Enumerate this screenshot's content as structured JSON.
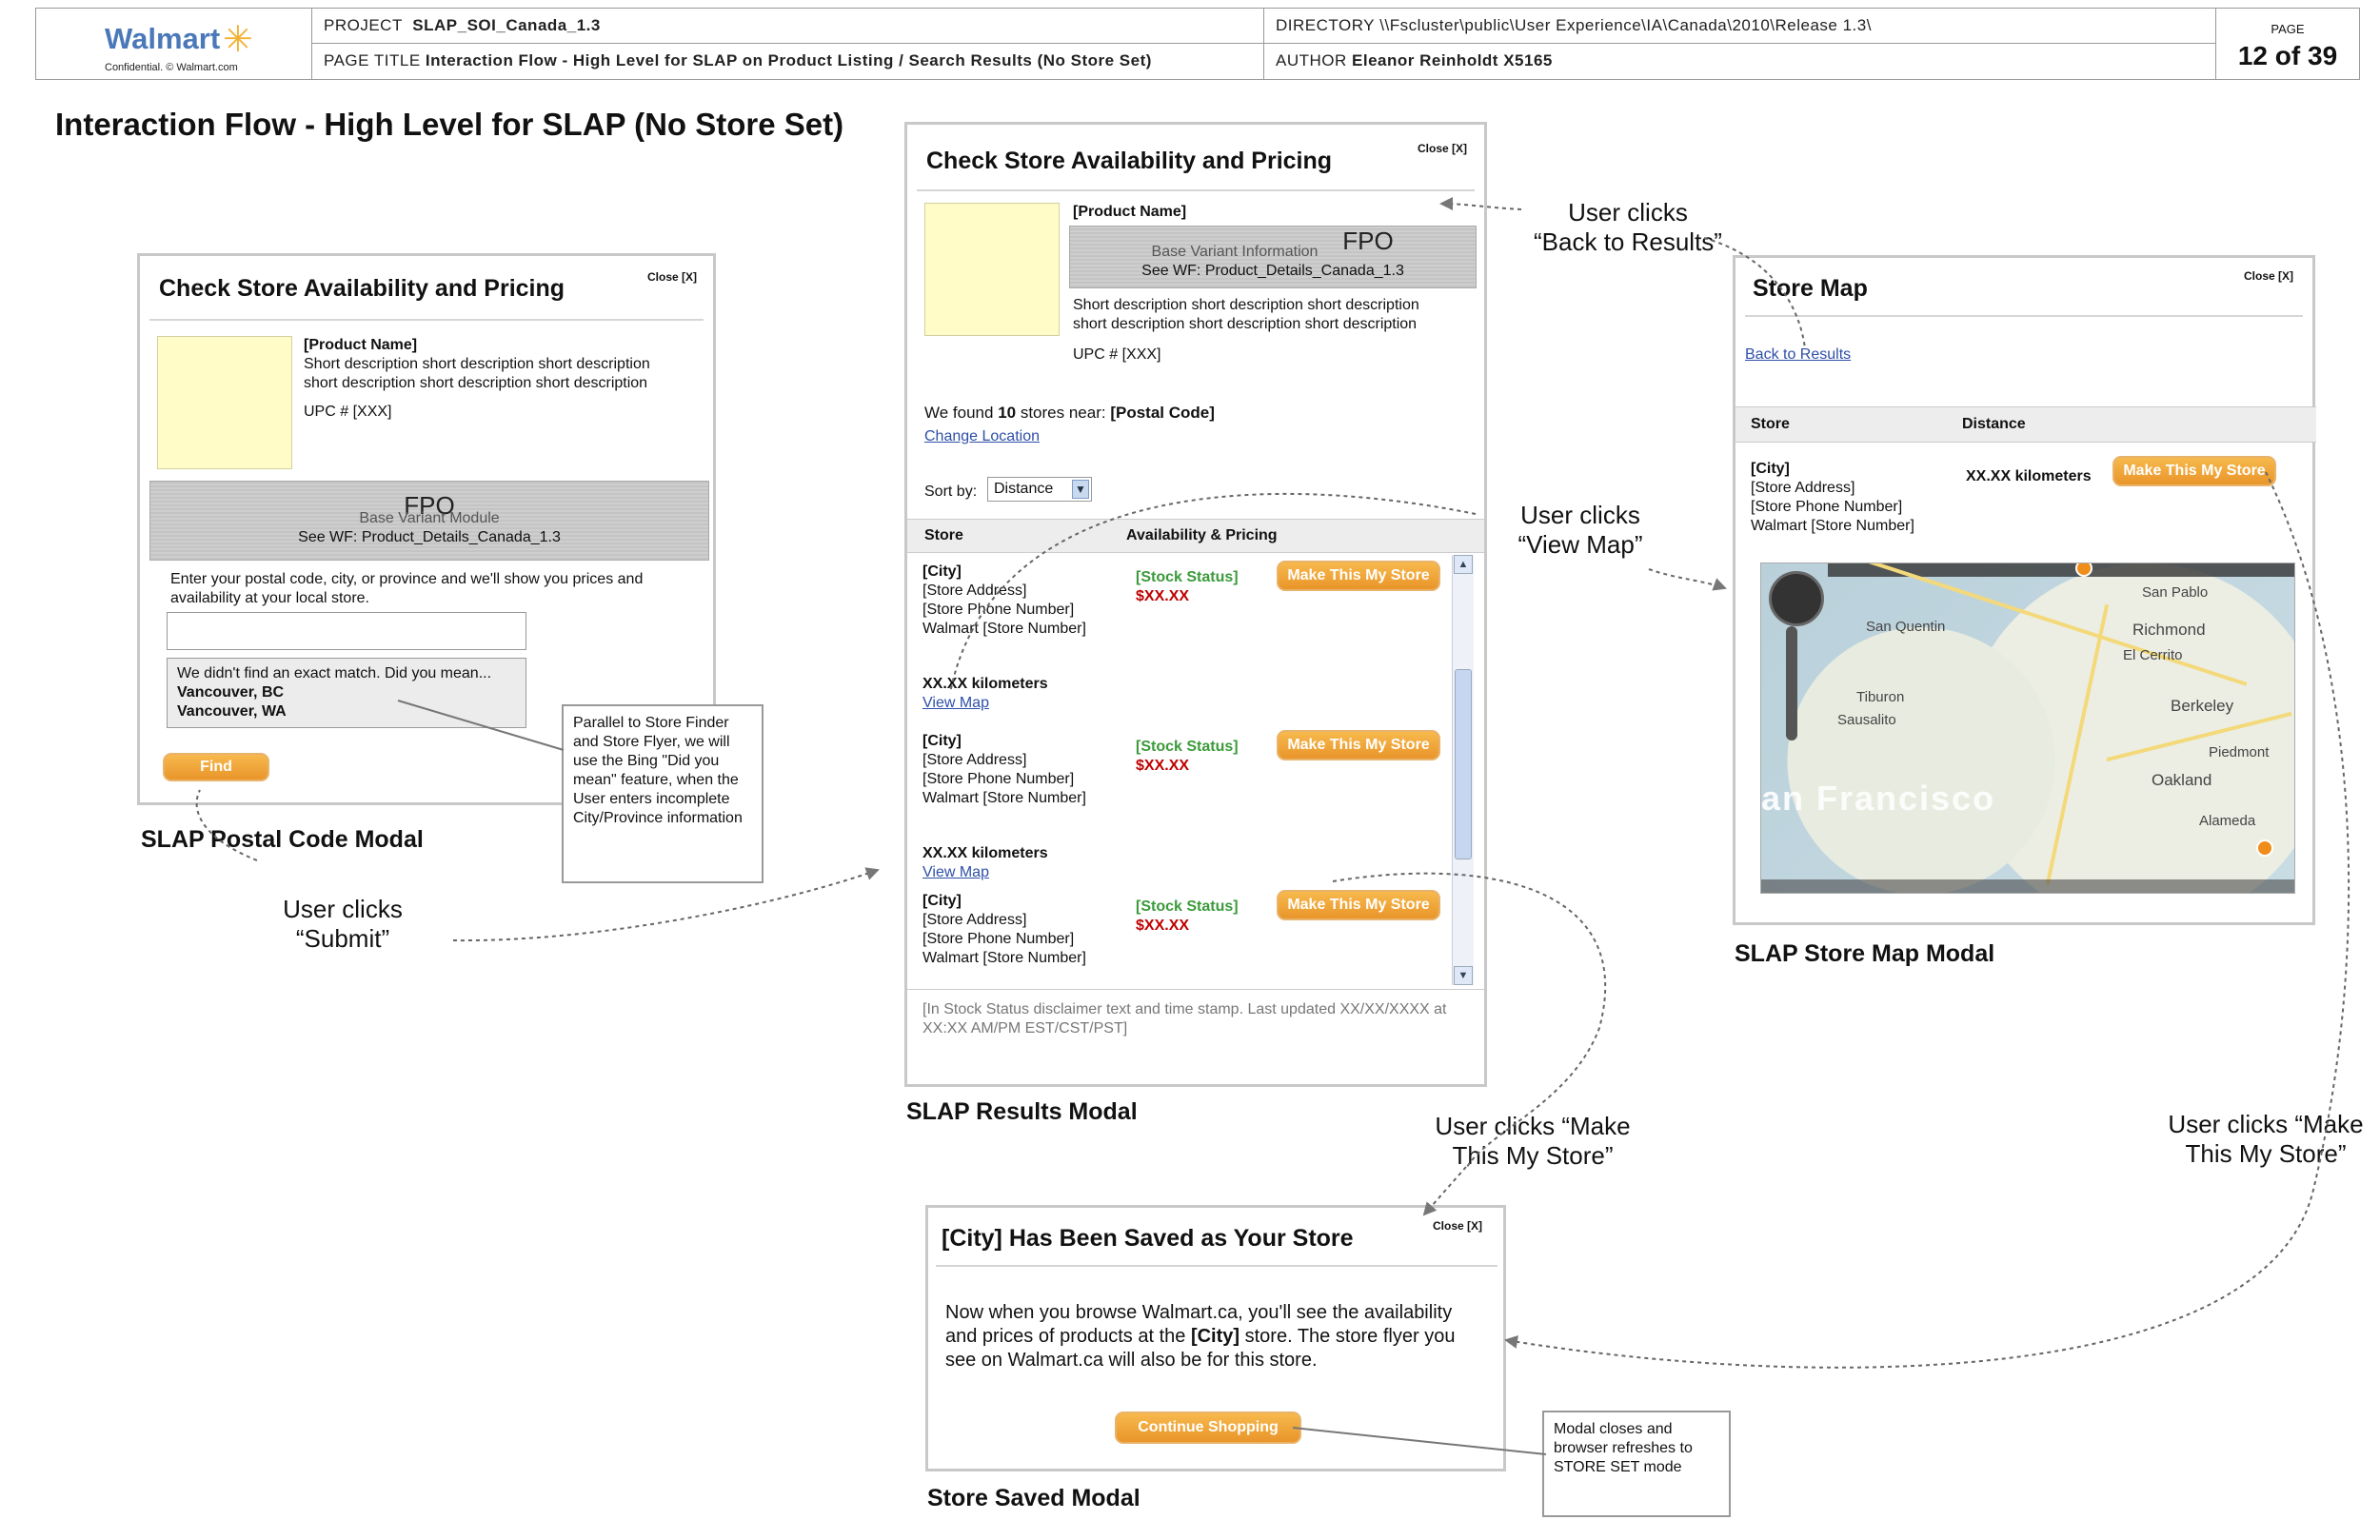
{
  "header": {
    "logo": "Walmart",
    "confidential": "Confidential. © Walmart.com",
    "project_label": "PROJECT",
    "project_value": "SLAP_SOI_Canada_1.3",
    "directory_label": "DIRECTORY",
    "directory_value": "\\\\Fscluster\\public\\User Experience\\IA\\Canada\\2010\\Release 1.3\\",
    "page_title_label": "PAGE TITLE",
    "page_title_value": "Interaction Flow - High Level  for SLAP on Product Listing /  Search Results (No Store Set)",
    "author_label": "AUTHOR",
    "author_value": "Eleanor Reinholdt X5165",
    "page_label": "PAGE",
    "page_value": "12 of 39"
  },
  "main_title": "Interaction Flow - High Level  for SLAP (No Store Set)",
  "postal_modal": {
    "title": "Check Store Availability and Pricing",
    "close": "Close [X]",
    "product_name": "[Product Name]",
    "desc1": "Short description short description short description",
    "desc2": "short description short description short description",
    "upc": "UPC # [XXX]",
    "fpo": "FPO",
    "fpo_sub": "Base Variant Module",
    "fpo_see": "See WF:  Product_Details_Canada_1.3",
    "prompt1": "Enter your postal code, city, or province and we'll show you prices and",
    "prompt2": "availability at your local store.",
    "suggest_q": "We didn't find an exact match. Did you mean...",
    "suggest_1": "Vancouver, BC",
    "suggest_2": "Vancouver, WA",
    "find": "Find",
    "caption": "SLAP Postal Code Modal"
  },
  "note_bing": "Parallel to Store Finder and Store Flyer, we will use the Bing \"Did you mean\" feature, when the User enters incomplete City/Province information",
  "callout_submit": [
    "User clicks",
    "“Submit”"
  ],
  "results_modal": {
    "title": "Check Store Availability and Pricing",
    "close": "Close [X]",
    "product_name": "[Product Name]",
    "fpo": "FPO",
    "fpo_sub": "Base Variant Information",
    "fpo_see": "See WF:  Product_Details_Canada_1.3",
    "desc1": "Short description short description short description",
    "desc2": "short description short description short description",
    "upc": "UPC # [XXX]",
    "found_pre": "We found ",
    "found_num": "10",
    "found_mid": " stores near: ",
    "found_loc": "[Postal Code]",
    "change_location": "Change Location",
    "sort_label": "Sort by:",
    "sort_value": "Distance",
    "col_store": "Store",
    "col_avail": "Availability & Pricing",
    "stores": [
      {
        "city": "[City]",
        "address": "[Store Address]",
        "phone": "[Store Phone Number]",
        "number": "Walmart [Store Number]",
        "stock": "[Stock Status]",
        "price": "$XX.XX",
        "btn": "Make This My Store",
        "km": "XX.XX kilometers",
        "map": "View Map"
      },
      {
        "city": "[City]",
        "address": "[Store Address]",
        "phone": "[Store Phone Number]",
        "number": "Walmart [Store Number]",
        "stock": "[Stock Status]",
        "price": "$XX.XX",
        "btn": "Make This My Store",
        "km": "XX.XX kilometers",
        "map": "View Map"
      },
      {
        "city": "[City]",
        "address": "[Store Address]",
        "phone": "[Store Phone Number]",
        "number": "Walmart [Store Number]",
        "stock": "[Stock Status]",
        "price": "$XX.XX",
        "btn": "Make This My Store"
      }
    ],
    "disclaimer1": "[In Stock Status disclaimer text and time stamp. Last updated XX/XX/XXXX at",
    "disclaimer2": "XX:XX AM/PM EST/CST/PST]",
    "caption": "SLAP Results Modal"
  },
  "callout_back": [
    "User clicks",
    "“Back to Results”"
  ],
  "callout_viewmap": [
    "User clicks",
    "“View Map”"
  ],
  "map_modal": {
    "title": "Store Map",
    "close": "Close [X]",
    "back": "Back to Results",
    "col_store": "Store",
    "col_distance": "Distance",
    "city": "[City]",
    "address": "[Store Address]",
    "phone": "[Store Phone Number]",
    "number": "Walmart [Store Number]",
    "km": "XX.XX kilometers",
    "btn": "Make This My Store",
    "map_labels": [
      "San Pablo",
      "Richmond",
      "El Cerrito",
      "Berkeley",
      "Oakland",
      "Alameda",
      "Piedmont",
      "San Quentin",
      "Tiburon",
      "Sausalito"
    ],
    "map_bay": "an Francisco",
    "caption": "SLAP Store Map Modal"
  },
  "callout_make1": [
    "User clicks “Make",
    "This My Store”"
  ],
  "callout_make2": [
    "User clicks “Make",
    "This My Store”"
  ],
  "saved_modal": {
    "title": "[City] Has Been Saved as Your Store",
    "close": "Close [X]",
    "body1": "Now when you browse Walmart.ca, you'll see the availability",
    "body2_pre": "and prices of products at the ",
    "body2_city": "[City]",
    "body2_post": " store. The store flyer you",
    "body3": "see on Walmart.ca will also be for this store.",
    "btn": "Continue Shopping",
    "caption": "Store Saved Modal"
  },
  "note_refresh": "Modal closes and browser refreshes to STORE SET mode"
}
